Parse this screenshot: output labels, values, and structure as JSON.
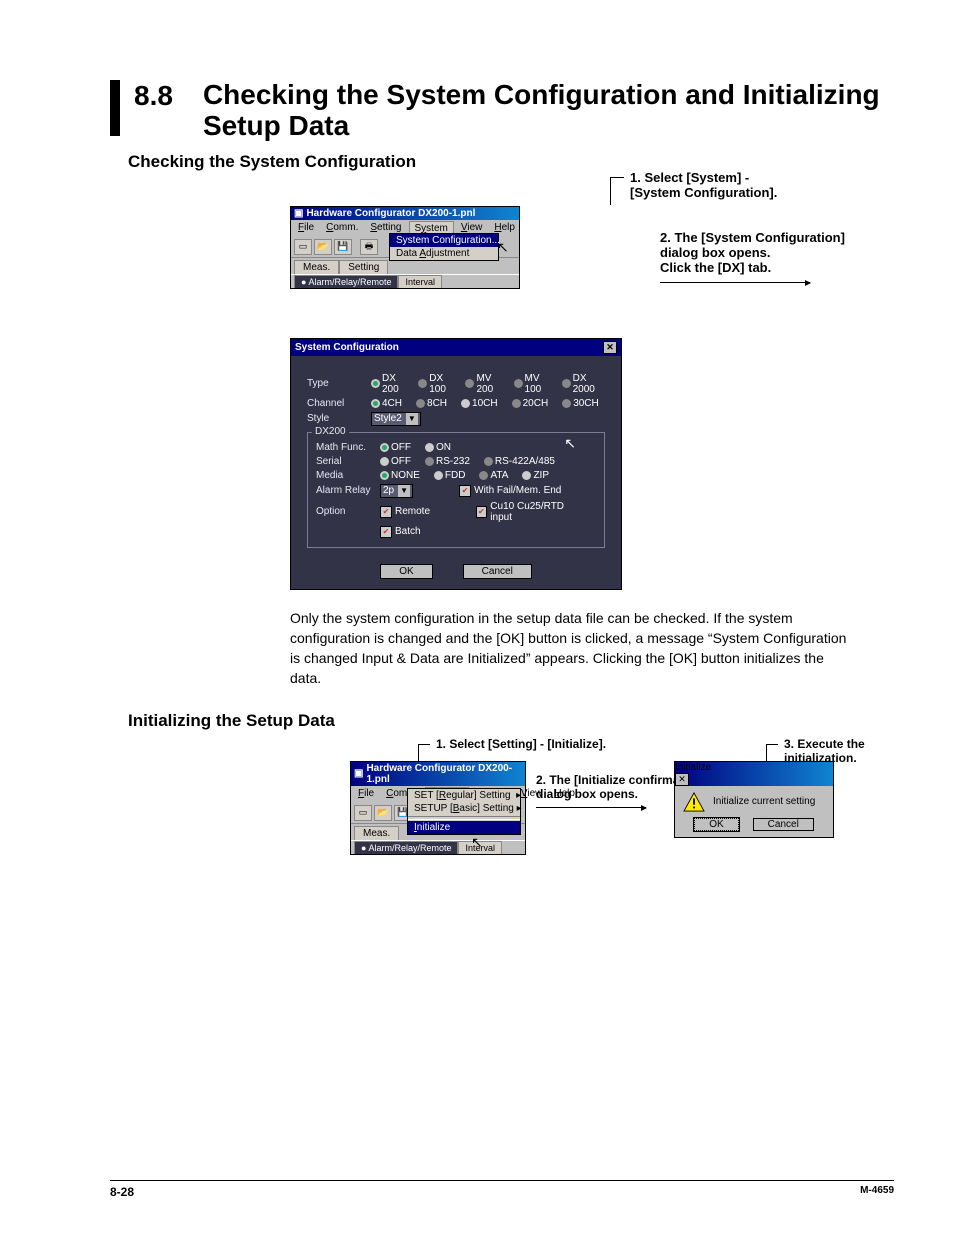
{
  "header": {
    "section_number": "8.8",
    "section_title": "Checking the System Configuration and Initializing Setup Data"
  },
  "sub1": "Checking the System Configuration",
  "callout1_line1": "1. Select [System] -",
  "callout1_line2": "[System Configuration].",
  "callout2_line1": "2. The [System Configuration]",
  "callout2_line2": "dialog box opens.",
  "callout2_line3": "Click the [DX] tab.",
  "win1": {
    "title": "Hardware Configurator DX200-1.pnl",
    "menus": {
      "file": "File",
      "comm": "Comm.",
      "setting": "Setting",
      "system": "System",
      "view": "View",
      "help": "Help"
    },
    "tabs": {
      "meas": "Meas.",
      "setting": "Setting"
    },
    "subtabs": {
      "alarm": "Alarm/Relay/Remote",
      "interval": "Interval"
    },
    "dropdown": {
      "item1": "System Configuration...",
      "item2": "Data Adjustment"
    }
  },
  "dlg": {
    "title": "System Configuration",
    "labels": {
      "type": "Type",
      "channel": "Channel",
      "style": "Style",
      "group": "DX200",
      "math": "Math Func.",
      "serial": "Serial",
      "media": "Media",
      "alarm": "Alarm Relay",
      "option": "Option"
    },
    "type_opts": [
      "DX 200",
      "DX 100",
      "MV 200",
      "MV 100",
      "DX 2000"
    ],
    "ch_opts": [
      "4CH",
      "8CH",
      "10CH",
      "20CH",
      "30CH"
    ],
    "style_val": "Style2",
    "math_opts": [
      "OFF",
      "ON"
    ],
    "serial_opts": [
      "OFF",
      "RS-232",
      "RS-422A/485"
    ],
    "media_opts": [
      "NONE",
      "FDD",
      "ATA",
      "ZIP"
    ],
    "alarm_val": "2p",
    "chk_fail": "With Fail/Mem. End",
    "chk_remote": "Remote",
    "chk_cu": "Cu10 Cu25/RTD input",
    "chk_batch": "Batch",
    "ok": "OK",
    "cancel": "Cancel"
  },
  "paragraph": "Only the system configuration in the setup data file can be checked.  If the system configuration is changed and the [OK] button is clicked, a message “System Configuration is changed Input & Data are Initialized” appears.  Clicking the [OK] button initializes the data.",
  "sub2": "Initializing the Setup Data",
  "callout3": "1. Select [Setting] - [Initialize].",
  "callout4_line1": "2. The [Initialize confirmation]",
  "callout4_line2": "dialog box opens.",
  "callout5": "3. Execute the initialization.",
  "win2": {
    "title": "Hardware Configurator DX200-1.pnl",
    "dropdown": {
      "i1": "SET [Regular] Setting",
      "i2": "SETUP [Basic] Setting",
      "i3": "Initialize"
    }
  },
  "initdlg": {
    "title": "Initialize",
    "msg": "Initialize current setting",
    "ok": "OK",
    "cancel": "Cancel"
  },
  "footer": {
    "left": "8-28",
    "right": "M-4659"
  }
}
